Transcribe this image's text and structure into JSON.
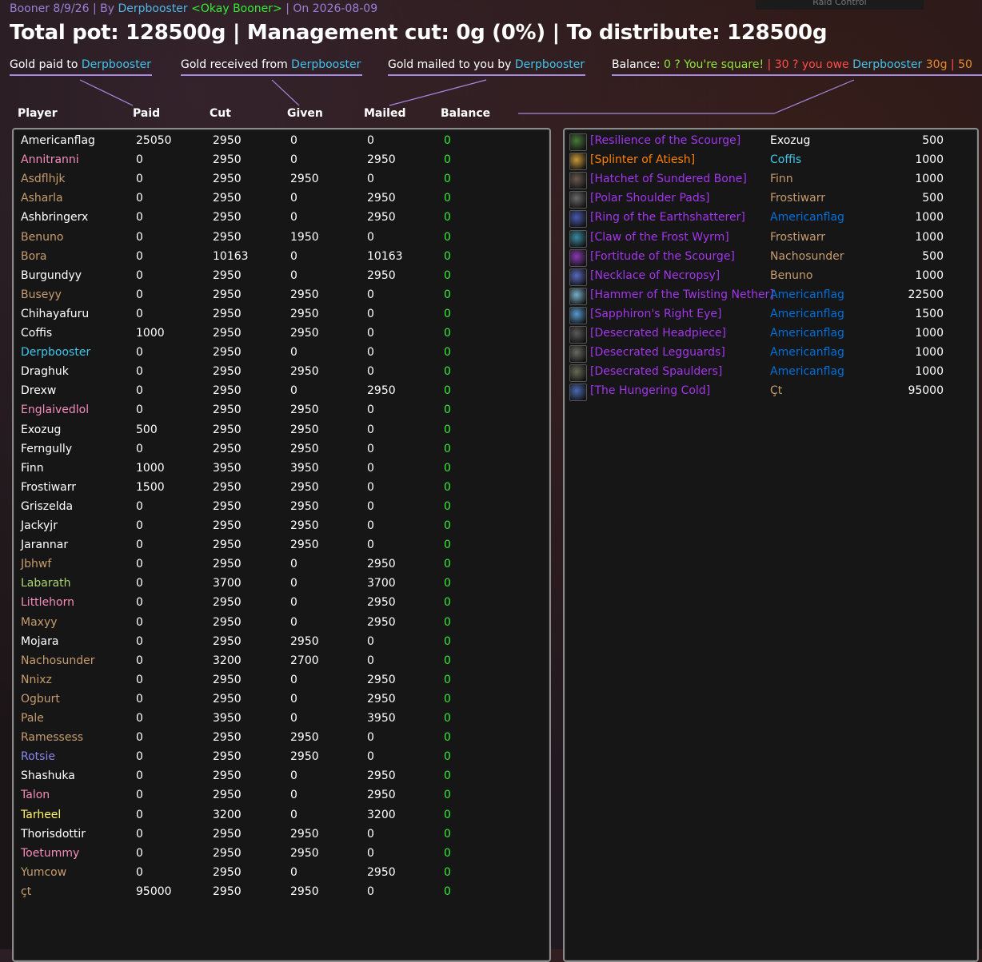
{
  "header": {
    "session_name": "Booner 8/9/26",
    "by_label": "| By",
    "author": "Derpbooster",
    "guild": "<Okay Booner>",
    "on_label": "| On",
    "date": "2026-08-09",
    "raid_control": "Raid Control"
  },
  "summary": {
    "text": "Total pot: 128500g | Management cut: 0g (0%) | To distribute: 128500g"
  },
  "legend": {
    "paid_prefix": "Gold paid to",
    "received_prefix": "Gold received from",
    "mailed_prefix": "Gold mailed to you by",
    "name": "Derpbooster",
    "balance_label": "Balance:",
    "square_text": "0 ? You're square!",
    "sep1": "|",
    "owe_prefix": "30 ? you owe",
    "owe_amount": "30g",
    "sep2": "|",
    "cut_off": "50"
  },
  "columns": {
    "player": "Player",
    "paid": "Paid",
    "cut": "Cut",
    "given": "Given",
    "mailed": "Mailed",
    "balance": "Balance"
  },
  "class_colors": {
    "warrior": "#c79c6e",
    "paladin": "#f58cba",
    "hunter": "#abd473",
    "rogue": "#fff569",
    "priest": "#ffffff",
    "mage": "#3fc7eb",
    "warlock": "#8787ed",
    "druid": "#ff7d0a",
    "shaman": "#0070de",
    "epic": "#a335ee",
    "legendary": "#ff8000"
  },
  "players": [
    {
      "name": "Americanflag",
      "color": "#ffffff",
      "paid": "25050",
      "cut": "2950",
      "given": "0",
      "mailed": "0",
      "balance": "0"
    },
    {
      "name": "Annitranni",
      "color": "#f58cba",
      "paid": "0",
      "cut": "2950",
      "given": "0",
      "mailed": "2950",
      "balance": "0"
    },
    {
      "name": "Asdflhjk",
      "color": "#c79c6e",
      "paid": "0",
      "cut": "2950",
      "given": "2950",
      "mailed": "0",
      "balance": "0"
    },
    {
      "name": "Asharla",
      "color": "#c79c6e",
      "paid": "0",
      "cut": "2950",
      "given": "0",
      "mailed": "2950",
      "balance": "0"
    },
    {
      "name": "Ashbringerx",
      "color": "#ffffff",
      "paid": "0",
      "cut": "2950",
      "given": "0",
      "mailed": "2950",
      "balance": "0"
    },
    {
      "name": "Benuno",
      "color": "#c79c6e",
      "paid": "0",
      "cut": "2950",
      "given": "1950",
      "mailed": "0",
      "balance": "0"
    },
    {
      "name": "Bora",
      "color": "#c79c6e",
      "paid": "0",
      "cut": "10163",
      "given": "0",
      "mailed": "10163",
      "balance": "0"
    },
    {
      "name": "Burgundyy",
      "color": "#ffffff",
      "paid": "0",
      "cut": "2950",
      "given": "0",
      "mailed": "2950",
      "balance": "0"
    },
    {
      "name": "Buseyy",
      "color": "#c79c6e",
      "paid": "0",
      "cut": "2950",
      "given": "2950",
      "mailed": "0",
      "balance": "0"
    },
    {
      "name": "Chihayafuru",
      "color": "#ffffff",
      "paid": "0",
      "cut": "2950",
      "given": "2950",
      "mailed": "0",
      "balance": "0"
    },
    {
      "name": "Coffis",
      "color": "#ffffff",
      "paid": "1000",
      "cut": "2950",
      "given": "2950",
      "mailed": "0",
      "balance": "0"
    },
    {
      "name": "Derpbooster",
      "color": "#3fc7eb",
      "paid": "0",
      "cut": "2950",
      "given": "0",
      "mailed": "0",
      "balance": "0"
    },
    {
      "name": "Draghuk",
      "color": "#ffffff",
      "paid": "0",
      "cut": "2950",
      "given": "2950",
      "mailed": "0",
      "balance": "0"
    },
    {
      "name": "Drexw",
      "color": "#ffffff",
      "paid": "0",
      "cut": "2950",
      "given": "0",
      "mailed": "2950",
      "balance": "0"
    },
    {
      "name": "Englaivedlol",
      "color": "#f58cba",
      "paid": "0",
      "cut": "2950",
      "given": "2950",
      "mailed": "0",
      "balance": "0"
    },
    {
      "name": "Exozug",
      "color": "#ffffff",
      "paid": "500",
      "cut": "2950",
      "given": "2950",
      "mailed": "0",
      "balance": "0"
    },
    {
      "name": "Ferngully",
      "color": "#ffffff",
      "paid": "0",
      "cut": "2950",
      "given": "2950",
      "mailed": "0",
      "balance": "0"
    },
    {
      "name": "Finn",
      "color": "#ffffff",
      "paid": "1000",
      "cut": "3950",
      "given": "3950",
      "mailed": "0",
      "balance": "0"
    },
    {
      "name": "Frostiwarr",
      "color": "#ffffff",
      "paid": "1500",
      "cut": "2950",
      "given": "2950",
      "mailed": "0",
      "balance": "0"
    },
    {
      "name": "Griszelda",
      "color": "#ffffff",
      "paid": "0",
      "cut": "2950",
      "given": "2950",
      "mailed": "0",
      "balance": "0"
    },
    {
      "name": "Jackyjr",
      "color": "#ffffff",
      "paid": "0",
      "cut": "2950",
      "given": "2950",
      "mailed": "0",
      "balance": "0"
    },
    {
      "name": "Jarannar",
      "color": "#ffffff",
      "paid": "0",
      "cut": "2950",
      "given": "2950",
      "mailed": "0",
      "balance": "0"
    },
    {
      "name": "Jbhwf",
      "color": "#c79c6e",
      "paid": "0",
      "cut": "2950",
      "given": "0",
      "mailed": "2950",
      "balance": "0"
    },
    {
      "name": "Labarath",
      "color": "#abd473",
      "paid": "0",
      "cut": "3700",
      "given": "0",
      "mailed": "3700",
      "balance": "0"
    },
    {
      "name": "Littlehorn",
      "color": "#f58cba",
      "paid": "0",
      "cut": "2950",
      "given": "0",
      "mailed": "2950",
      "balance": "0"
    },
    {
      "name": "Maxyy",
      "color": "#c79c6e",
      "paid": "0",
      "cut": "2950",
      "given": "0",
      "mailed": "2950",
      "balance": "0"
    },
    {
      "name": "Mojara",
      "color": "#ffffff",
      "paid": "0",
      "cut": "2950",
      "given": "2950",
      "mailed": "0",
      "balance": "0"
    },
    {
      "name": "Nachosunder",
      "color": "#c79c6e",
      "paid": "0",
      "cut": "3200",
      "given": "2700",
      "mailed": "0",
      "balance": "0"
    },
    {
      "name": "Nnixz",
      "color": "#c79c6e",
      "paid": "0",
      "cut": "2950",
      "given": "0",
      "mailed": "2950",
      "balance": "0"
    },
    {
      "name": "Ogburt",
      "color": "#c79c6e",
      "paid": "0",
      "cut": "2950",
      "given": "0",
      "mailed": "2950",
      "balance": "0"
    },
    {
      "name": "Pale",
      "color": "#c79c6e",
      "paid": "0",
      "cut": "3950",
      "given": "0",
      "mailed": "3950",
      "balance": "0"
    },
    {
      "name": "Ramessess",
      "color": "#c79c6e",
      "paid": "0",
      "cut": "2950",
      "given": "2950",
      "mailed": "0",
      "balance": "0"
    },
    {
      "name": "Rotsie",
      "color": "#8787ed",
      "paid": "0",
      "cut": "2950",
      "given": "2950",
      "mailed": "0",
      "balance": "0"
    },
    {
      "name": "Shashuka",
      "color": "#ffffff",
      "paid": "0",
      "cut": "2950",
      "given": "0",
      "mailed": "2950",
      "balance": "0"
    },
    {
      "name": "Talon",
      "color": "#f58cba",
      "paid": "0",
      "cut": "2950",
      "given": "0",
      "mailed": "2950",
      "balance": "0"
    },
    {
      "name": "Tarheel",
      "color": "#fff569",
      "paid": "0",
      "cut": "3200",
      "given": "0",
      "mailed": "3200",
      "balance": "0"
    },
    {
      "name": "Thorisdottir",
      "color": "#ffffff",
      "paid": "0",
      "cut": "2950",
      "given": "2950",
      "mailed": "0",
      "balance": "0"
    },
    {
      "name": "Toetummy",
      "color": "#f58cba",
      "paid": "0",
      "cut": "2950",
      "given": "2950",
      "mailed": "0",
      "balance": "0"
    },
    {
      "name": "Yumcow",
      "color": "#c79c6e",
      "paid": "0",
      "cut": "2950",
      "given": "0",
      "mailed": "2950",
      "balance": "0"
    },
    {
      "name": "çt",
      "color": "#c79c6e",
      "paid": "95000",
      "cut": "2950",
      "given": "2950",
      "mailed": "0",
      "balance": "0"
    }
  ],
  "items": [
    {
      "name": "[Resilience of the Scourge]",
      "color": "#a335ee",
      "icon": "spell-icon",
      "icon_color": "#4a7a3a",
      "winner": "Exozug",
      "winner_color": "#ffffff",
      "amount": "500"
    },
    {
      "name": "[Splinter of Atiesh]",
      "color": "#ff8000",
      "icon": "splinter-icon",
      "icon_color": "#c89a3a",
      "winner": "Coffis",
      "winner_color": "#3fc7eb",
      "amount": "1000"
    },
    {
      "name": "[Hatchet of Sundered Bone]",
      "color": "#a335ee",
      "icon": "axe-icon",
      "icon_color": "#6a5a50",
      "winner": "Finn",
      "winner_color": "#c79c6e",
      "amount": "1000"
    },
    {
      "name": "[Polar Shoulder Pads]",
      "color": "#a335ee",
      "icon": "shoulder-icon",
      "icon_color": "#6b6b6b",
      "winner": "Frostiwarr",
      "winner_color": "#c79c6e",
      "amount": "500"
    },
    {
      "name": "[Ring of the Earthshatterer]",
      "color": "#a335ee",
      "icon": "ring-icon",
      "icon_color": "#4a5ab0",
      "winner": "Americanflag",
      "winner_color": "#0070de",
      "amount": "1000"
    },
    {
      "name": "[Claw of the Frost Wyrm]",
      "color": "#a335ee",
      "icon": "claw-icon",
      "icon_color": "#3a8aa0",
      "winner": "Frostiwarr",
      "winner_color": "#c79c6e",
      "amount": "1000"
    },
    {
      "name": "[Fortitude of the Scourge]",
      "color": "#a335ee",
      "icon": "spell-icon",
      "icon_color": "#8a3ab0",
      "winner": "Nachosunder",
      "winner_color": "#c79c6e",
      "amount": "500"
    },
    {
      "name": "[Necklace of Necropsy]",
      "color": "#a335ee",
      "icon": "necklace-icon",
      "icon_color": "#5a6ac0",
      "winner": "Benuno",
      "winner_color": "#c79c6e",
      "amount": "1000"
    },
    {
      "name": "[Hammer of the Twisting Nether]",
      "color": "#a335ee",
      "icon": "hammer-icon",
      "icon_color": "#7ab0c8",
      "winner": "Americanflag",
      "winner_color": "#0070de",
      "amount": "22500"
    },
    {
      "name": "[Sapphiron's Right Eye]",
      "color": "#a335ee",
      "icon": "eye-icon",
      "icon_color": "#5a9ad0",
      "winner": "Americanflag",
      "winner_color": "#0070de",
      "amount": "1500"
    },
    {
      "name": "[Desecrated Headpiece]",
      "color": "#a335ee",
      "icon": "helm-icon",
      "icon_color": "#5a5a5a",
      "winner": "Americanflag",
      "winner_color": "#0070de",
      "amount": "1000"
    },
    {
      "name": "[Desecrated Legguards]",
      "color": "#a335ee",
      "icon": "legs-icon",
      "icon_color": "#6a6a60",
      "winner": "Americanflag",
      "winner_color": "#0070de",
      "amount": "1000"
    },
    {
      "name": "[Desecrated Spaulders]",
      "color": "#a335ee",
      "icon": "shoulder-icon",
      "icon_color": "#6a6a5a",
      "winner": "Americanflag",
      "winner_color": "#0070de",
      "amount": "1000"
    },
    {
      "name": "[The Hungering Cold]",
      "color": "#a335ee",
      "icon": "frost-icon",
      "icon_color": "#4a6ab0",
      "winner": "Çt",
      "winner_color": "#c79c6e",
      "amount": "95000"
    }
  ]
}
